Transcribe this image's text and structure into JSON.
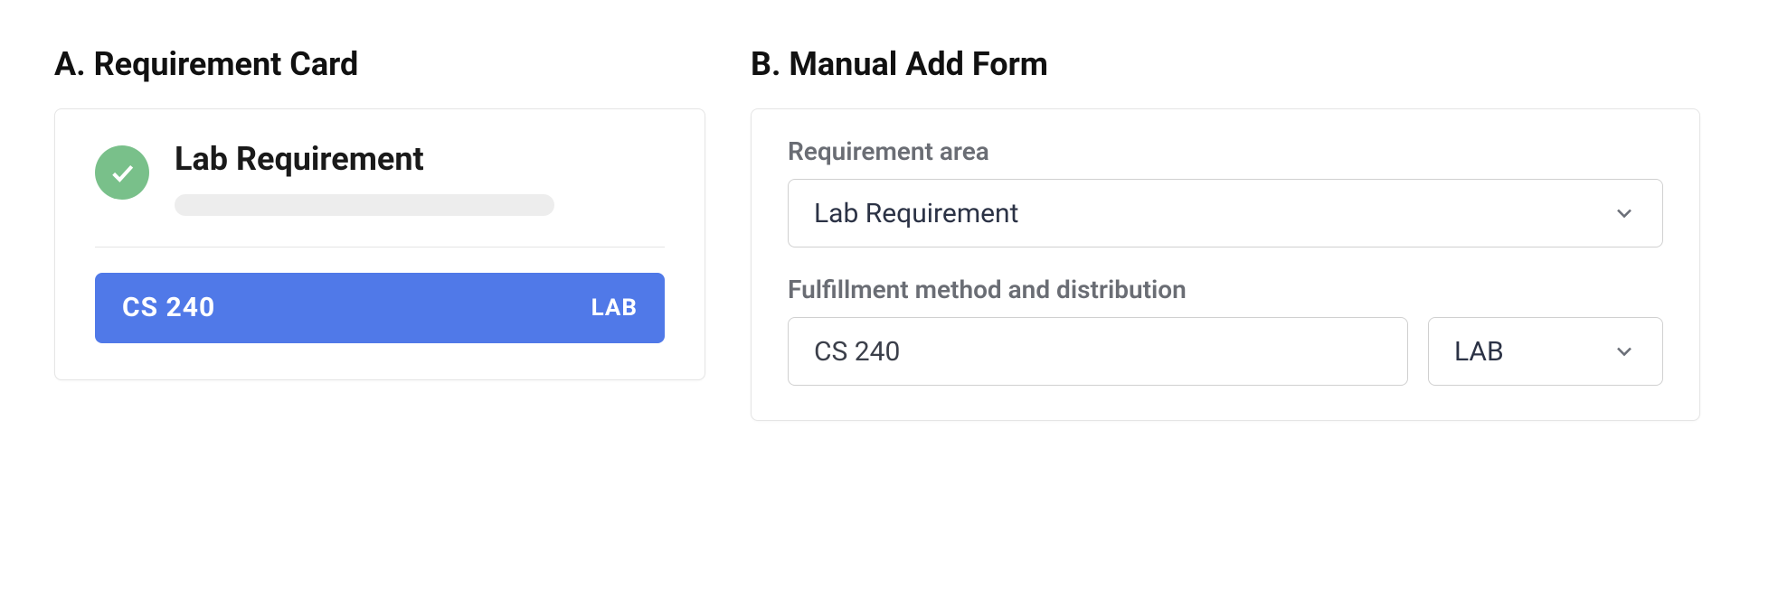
{
  "panelA": {
    "heading": "A. Requirement Card",
    "title": "Lab Requirement",
    "courseCode": "CS  240",
    "courseTag": "LAB"
  },
  "panelB": {
    "heading": "B. Manual Add Form",
    "field1": {
      "label": "Requirement area",
      "value": "Lab Requirement"
    },
    "field2": {
      "label": "Fulfillment method and distribution",
      "inputValue": "CS 240",
      "selectValue": "LAB"
    }
  }
}
